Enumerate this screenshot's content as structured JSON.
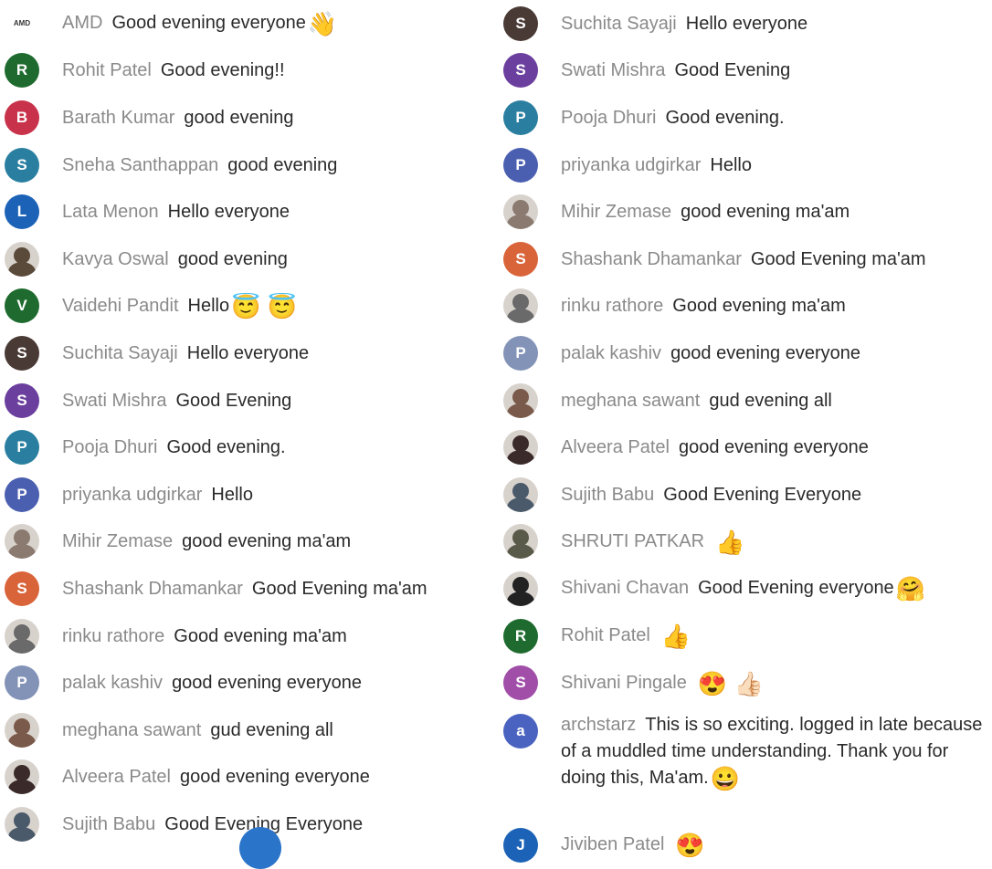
{
  "left_column": [
    {
      "name": "AMD",
      "message": "Good evening everyone",
      "emoji": "👋",
      "avatar": {
        "type": "logo",
        "letter": "AMD",
        "color": "#ffffff"
      }
    },
    {
      "name": "Rohit Patel",
      "message": "Good evening!!",
      "emoji": "",
      "avatar": {
        "type": "letter",
        "letter": "R",
        "color": "#1f6b2f"
      }
    },
    {
      "name": "Barath Kumar",
      "message": "good evening",
      "emoji": "",
      "avatar": {
        "type": "letter",
        "letter": "B",
        "color": "#c8324a"
      }
    },
    {
      "name": "Sneha Santhappan",
      "message": "good evening",
      "emoji": "",
      "avatar": {
        "type": "letter",
        "letter": "S",
        "color": "#2a7fa1"
      }
    },
    {
      "name": "Lata Menon",
      "message": "Hello everyone",
      "emoji": "",
      "avatar": {
        "type": "letter",
        "letter": "L",
        "color": "#1c63b7"
      }
    },
    {
      "name": "Kavya Oswal",
      "message": "good evening",
      "emoji": "",
      "avatar": {
        "type": "photo",
        "letter": "",
        "color": "#5a4a3a"
      }
    },
    {
      "name": "Vaidehi Pandit",
      "message": "Hello",
      "emoji": "😇 😇",
      "avatar": {
        "type": "letter",
        "letter": "V",
        "color": "#1f6b2f"
      }
    },
    {
      "name": "Suchita Sayaji",
      "message": "Hello everyone",
      "emoji": "",
      "avatar": {
        "type": "letter",
        "letter": "S",
        "color": "#4a3a36"
      }
    },
    {
      "name": "Swati Mishra",
      "message": "Good Evening",
      "emoji": "",
      "avatar": {
        "type": "letter",
        "letter": "S",
        "color": "#6b3f9e"
      }
    },
    {
      "name": "Pooja Dhuri",
      "message": "Good evening.",
      "emoji": "",
      "avatar": {
        "type": "letter",
        "letter": "P",
        "color": "#2a7fa1"
      }
    },
    {
      "name": "priyanka udgirkar",
      "message": "Hello",
      "emoji": "",
      "avatar": {
        "type": "letter",
        "letter": "P",
        "color": "#4a5fb0"
      }
    },
    {
      "name": "Mihir Zemase",
      "message": "good evening ma'am",
      "emoji": "",
      "avatar": {
        "type": "photo",
        "letter": "",
        "color": "#8a7a70"
      }
    },
    {
      "name": "Shashank Dhamankar",
      "message": "Good Evening ma'am",
      "emoji": "",
      "avatar": {
        "type": "letter",
        "letter": "S",
        "color": "#d9643a"
      }
    },
    {
      "name": "rinku rathore",
      "message": "Good evening ma'am",
      "emoji": "",
      "avatar": {
        "type": "photo",
        "letter": "",
        "color": "#6a6a6a"
      }
    },
    {
      "name": "palak kashiv",
      "message": "good evening everyone",
      "emoji": "",
      "avatar": {
        "type": "letter",
        "letter": "P",
        "color": "#8393b8"
      }
    },
    {
      "name": "meghana sawant",
      "message": "gud evening all",
      "emoji": "",
      "avatar": {
        "type": "photo",
        "letter": "",
        "color": "#7a5a4a"
      }
    },
    {
      "name": "Alveera Patel",
      "message": "good evening everyone",
      "emoji": "",
      "avatar": {
        "type": "photo",
        "letter": "",
        "color": "#3a2a2a"
      }
    },
    {
      "name": "Sujith Babu",
      "message": "Good Evening Everyone",
      "emoji": "",
      "avatar": {
        "type": "photo",
        "letter": "",
        "color": "#4a5a6a"
      }
    }
  ],
  "right_column": [
    {
      "name": "Suchita Sayaji",
      "message": "Hello everyone",
      "emoji": "",
      "avatar": {
        "type": "letter",
        "letter": "S",
        "color": "#4a3a36"
      }
    },
    {
      "name": "Swati Mishra",
      "message": "Good Evening",
      "emoji": "",
      "avatar": {
        "type": "letter",
        "letter": "S",
        "color": "#6b3f9e"
      }
    },
    {
      "name": "Pooja Dhuri",
      "message": "Good evening.",
      "emoji": "",
      "avatar": {
        "type": "letter",
        "letter": "P",
        "color": "#2a7fa1"
      }
    },
    {
      "name": "priyanka udgirkar",
      "message": "Hello",
      "emoji": "",
      "avatar": {
        "type": "letter",
        "letter": "P",
        "color": "#4a5fb0"
      }
    },
    {
      "name": "Mihir Zemase",
      "message": "good evening ma'am",
      "emoji": "",
      "avatar": {
        "type": "photo",
        "letter": "",
        "color": "#8a7a70"
      }
    },
    {
      "name": "Shashank Dhamankar",
      "message": "Good Evening ma'am",
      "emoji": "",
      "avatar": {
        "type": "letter",
        "letter": "S",
        "color": "#d9643a"
      }
    },
    {
      "name": "rinku rathore",
      "message": "Good evening ma'am",
      "emoji": "",
      "avatar": {
        "type": "photo",
        "letter": "",
        "color": "#6a6a6a"
      }
    },
    {
      "name": "palak kashiv",
      "message": "good evening everyone",
      "emoji": "",
      "avatar": {
        "type": "letter",
        "letter": "P",
        "color": "#8393b8"
      }
    },
    {
      "name": "meghana sawant",
      "message": "gud evening all",
      "emoji": "",
      "avatar": {
        "type": "photo",
        "letter": "",
        "color": "#7a5a4a"
      }
    },
    {
      "name": "Alveera Patel",
      "message": "good evening everyone",
      "emoji": "",
      "avatar": {
        "type": "photo",
        "letter": "",
        "color": "#3a2a2a"
      }
    },
    {
      "name": "Sujith Babu",
      "message": "Good Evening Everyone",
      "emoji": "",
      "avatar": {
        "type": "photo",
        "letter": "",
        "color": "#4a5a6a"
      }
    },
    {
      "name": "SHRUTI PATKAR",
      "message": "",
      "emoji": "👍",
      "avatar": {
        "type": "photo",
        "letter": "",
        "color": "#5a5a4a"
      }
    },
    {
      "name": "Shivani Chavan",
      "message": "Good Evening everyone",
      "emoji": "🤗",
      "avatar": {
        "type": "photo",
        "letter": "",
        "color": "#222222"
      }
    },
    {
      "name": "Rohit Patel",
      "message": "",
      "emoji": "👍",
      "avatar": {
        "type": "letter",
        "letter": "R",
        "color": "#1f6b2f"
      }
    },
    {
      "name": "Shivani Pingale",
      "message": "",
      "emoji": "😍 👍🏻",
      "avatar": {
        "type": "letter",
        "letter": "S",
        "color": "#a04ea8"
      }
    },
    {
      "name": "archstarz",
      "message": "This is so exciting. logged in late because of a muddled time understanding. Thank you for doing this, Ma'am.",
      "emoji": "😀",
      "avatar": {
        "type": "letter",
        "letter": "a",
        "color": "#4a63c0"
      }
    },
    {
      "name": "Jiviben Patel",
      "message": "",
      "emoji": "😍",
      "avatar": {
        "type": "letter",
        "letter": "J",
        "color": "#1c63b7"
      }
    }
  ]
}
